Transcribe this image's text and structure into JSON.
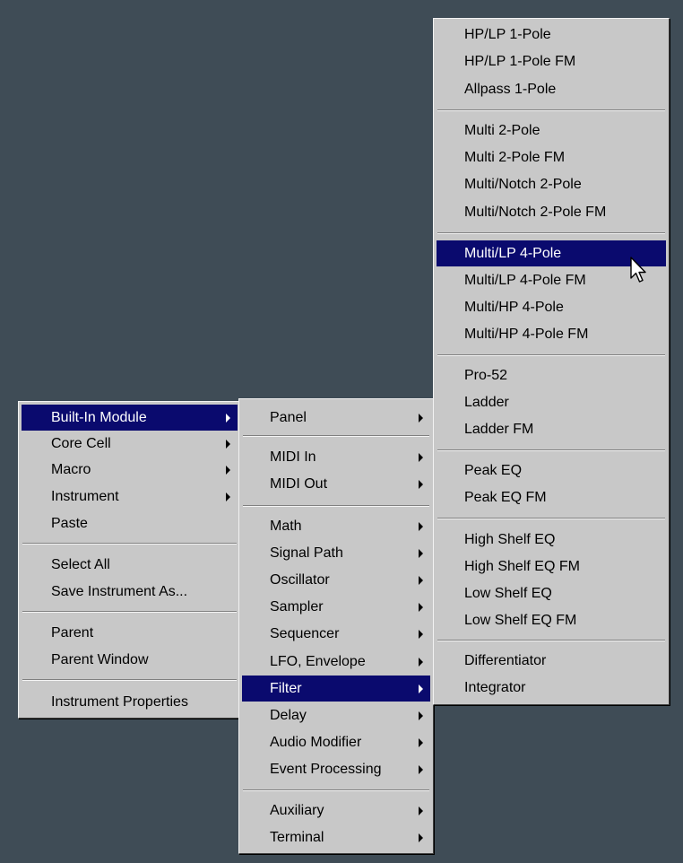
{
  "context_menu": {
    "items": [
      {
        "label": "Built-In Module",
        "submenu": true,
        "selected": true
      },
      {
        "label": "Core Cell",
        "submenu": true
      },
      {
        "label": "Macro",
        "submenu": true
      },
      {
        "label": "Instrument",
        "submenu": true
      },
      {
        "label": "Paste"
      },
      {
        "label": "Select All"
      },
      {
        "label": "Save Instrument As..."
      },
      {
        "label": "Parent"
      },
      {
        "label": "Parent Window"
      },
      {
        "label": "Instrument Properties"
      }
    ]
  },
  "builtin_submenu": {
    "items": [
      {
        "label": "Panel",
        "submenu": true
      },
      {
        "label": "MIDI In",
        "submenu": true
      },
      {
        "label": "MIDI Out",
        "submenu": true
      },
      {
        "label": "Math",
        "submenu": true
      },
      {
        "label": "Signal Path",
        "submenu": true
      },
      {
        "label": "Oscillator",
        "submenu": true
      },
      {
        "label": "Sampler",
        "submenu": true
      },
      {
        "label": "Sequencer",
        "submenu": true
      },
      {
        "label": "LFO, Envelope",
        "submenu": true
      },
      {
        "label": "Filter",
        "submenu": true,
        "selected": true
      },
      {
        "label": "Delay",
        "submenu": true
      },
      {
        "label": "Audio Modifier",
        "submenu": true
      },
      {
        "label": "Event Processing",
        "submenu": true
      },
      {
        "label": "Auxiliary",
        "submenu": true
      },
      {
        "label": "Terminal",
        "submenu": true
      }
    ]
  },
  "filter_submenu": {
    "items": [
      {
        "label": "HP/LP 1-Pole"
      },
      {
        "label": "HP/LP 1-Pole FM"
      },
      {
        "label": "Allpass 1-Pole"
      },
      {
        "label": "Multi 2-Pole"
      },
      {
        "label": "Multi 2-Pole FM"
      },
      {
        "label": "Multi/Notch 2-Pole"
      },
      {
        "label": "Multi/Notch 2-Pole FM"
      },
      {
        "label": "Multi/LP 4-Pole",
        "selected": true
      },
      {
        "label": "Multi/LP 4-Pole FM"
      },
      {
        "label": "Multi/HP 4-Pole"
      },
      {
        "label": "Multi/HP 4-Pole FM"
      },
      {
        "label": "Pro-52"
      },
      {
        "label": "Ladder"
      },
      {
        "label": "Ladder FM"
      },
      {
        "label": "Peak EQ"
      },
      {
        "label": "Peak EQ FM"
      },
      {
        "label": "High Shelf EQ"
      },
      {
        "label": "High Shelf EQ FM"
      },
      {
        "label": "Low Shelf EQ"
      },
      {
        "label": "Low Shelf EQ FM"
      },
      {
        "label": "Differentiator"
      },
      {
        "label": "Integrator"
      }
    ]
  },
  "colors": {
    "desktop": "#3f4c56",
    "menu_bg": "#c8c8c8",
    "highlight": "#0a0a6e"
  }
}
